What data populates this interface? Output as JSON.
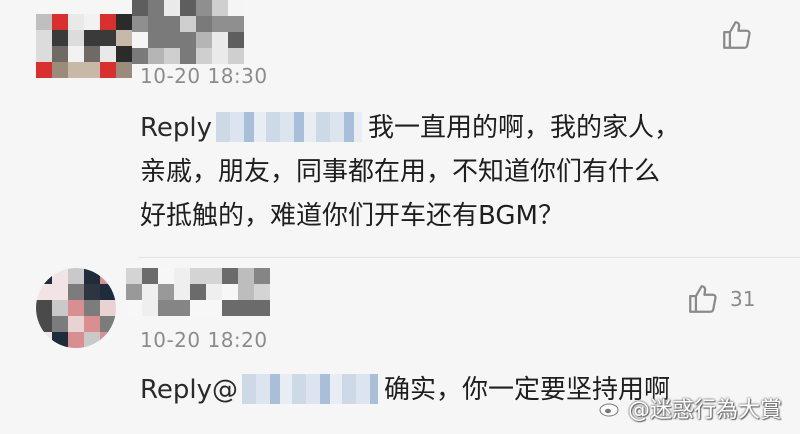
{
  "comments": [
    {
      "timestamp": "10-20 18:30",
      "like_count": "",
      "reply_prefix": "Reply",
      "lines": [
        "我一直用的啊，我的家人，",
        "亲戚，朋友，同事都在用，不知道你们有什么",
        "好抵触的，难道你们开车还有BGM？"
      ]
    },
    {
      "timestamp": "10-20 18:20",
      "like_count": "31",
      "reply_prefix": "Reply@",
      "lines": [
        "确实，你一定要坚持用啊"
      ]
    }
  ],
  "watermark": {
    "text": "@迷惑行為大賞",
    "logo": "weibo-logo"
  },
  "icons": {
    "like": "thumbs-up-icon"
  },
  "colors": {
    "background": "#f6f6f6",
    "timestamp": "#8c8c8c",
    "icon": "#8a8a8a"
  }
}
